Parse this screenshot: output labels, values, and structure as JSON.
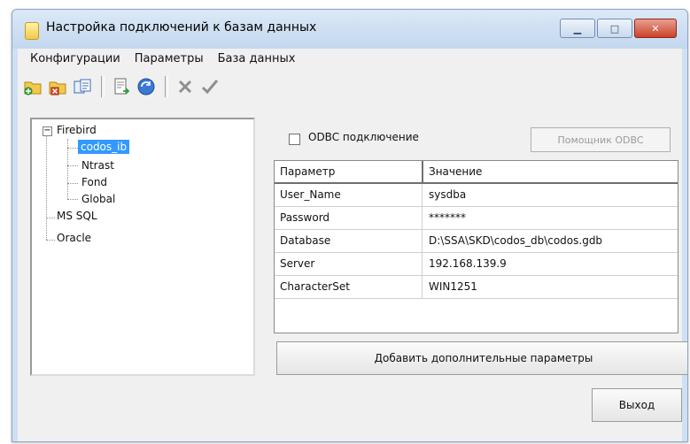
{
  "window": {
    "title": "Настройка подключений к базам данных"
  },
  "menu": [
    "Конфигурации",
    "Параметры",
    "База данных"
  ],
  "toolbar": {
    "icons": [
      "folder-add-icon",
      "folder-delete-icon",
      "copy-icon",
      "export-icon",
      "refresh-icon",
      "cancel-icon",
      "confirm-icon"
    ]
  },
  "tree": {
    "root_firebird": "Firebird",
    "firebird_children": [
      "codos_ib",
      "Ntrast",
      "Fond",
      "Global"
    ],
    "selected": "codos_ib",
    "ms_sql": "MS SQL",
    "oracle": "Oracle"
  },
  "odbc": {
    "checkbox_label": "ODBC подключение",
    "checked": false,
    "helper_button": "Помощник ODBC"
  },
  "grid": {
    "headers": [
      "Параметр",
      "Значение"
    ],
    "rows": [
      {
        "param": "User_Name",
        "value": "sysdba"
      },
      {
        "param": "Password",
        "value": "*******"
      },
      {
        "param": "Database",
        "value": "D:\\SSA\\SKD\\codos_db\\codos.gdb"
      },
      {
        "param": "Server",
        "value": "192.168.139.9"
      },
      {
        "param": "CharacterSet",
        "value": "WIN1251"
      }
    ]
  },
  "buttons": {
    "add_params": "Добавить дополнительные параметры",
    "exit": "Выход"
  },
  "colors": {
    "selection": "#3399ff",
    "close_button": "#c9432a"
  }
}
